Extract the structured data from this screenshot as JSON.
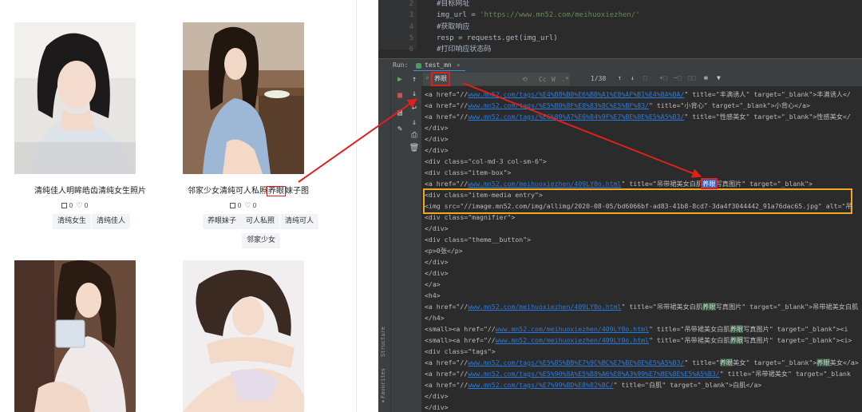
{
  "web": {
    "cards": [
      {
        "title": "清纯佳人明眸皓齿清纯女生照片",
        "likes": "0",
        "favs": "0",
        "tags": [
          "清纯女生",
          "清纯佳人"
        ]
      },
      {
        "title_before": "邻家少女清纯可人私照",
        "title_highlight": "养眼",
        "title_after": "妹子图",
        "likes": "0",
        "favs": "0",
        "tags": [
          "养眼妹子",
          "可人私照",
          "清纯可人",
          "邻家少女"
        ]
      },
      {
        "title": "",
        "tags": []
      },
      {
        "title": "",
        "tags": []
      }
    ]
  },
  "ide": {
    "editor_lines": [
      {
        "num": "2",
        "comment": "#目标网址"
      },
      {
        "num": "3",
        "code_before": "img_url = ",
        "string": "'https://www.mn52.com/meihuoxiezhen/'"
      },
      {
        "num": "4",
        "comment": "#获取响应"
      },
      {
        "num": "5",
        "code": "resp = requests.get(img_url)"
      },
      {
        "num": "6",
        "comment": "#打印响应状态码"
      }
    ],
    "run_label": "Run:",
    "run_tab": "test_mn",
    "find": {
      "query": "养眼",
      "count": "1/38",
      "options": [
        "Cc",
        "W",
        ".*"
      ]
    },
    "side_tabs": [
      "Structure",
      "Favorites"
    ],
    "console_lines": [
      {
        "t": "<a href=\"//",
        "u": "www.mn52.com/tags/%E4%B8%B0%E6%BB%A1%E8%AF%B1%E4%BA%BA/",
        "r": "\" title=\"丰满诱人\" target=\"_blank\">丰满诱人</"
      },
      {
        "t": "<a href=\"//",
        "u": "www.mn52.com/tags/%E5%B0%8F%E8%83%8C%E5%BF%83/",
        "r": "\" title=\"小背心\" target=\"_blank\">小背心</a>"
      },
      {
        "t": "<a href=\"//",
        "u": "www.mn52.com/tags/%E6%80%A7%E6%84%9F%E7%BE%8E%E5%A5%B3/",
        "r": "\" title=\"性感美女\" target=\"_blank\">性感美女</"
      },
      {
        "t": "</div>"
      },
      {
        "t": "</div>"
      },
      {
        "t": "</div>"
      },
      {
        "t": "<div class=\"col-md-3 col-sm-6\">"
      },
      {
        "t": "<div class=\"item-box\">"
      },
      {
        "t": "<a href=\"//",
        "u": "www.mn52.com/meihuoxiezhen/409LY0o.html",
        "r": "\" title=\"吊带裙美女白肌",
        "m": "养眼",
        "mc": true,
        "r2": "写真图片\" target=\"_blank\">"
      },
      {
        "t": "<div class=\"item-media entry\">"
      },
      {
        "t": "<img src=\"//image.mn52.com/img/allimg/2020-08-05/bd6066bf-ad83-41b8-8cd7-3da4f3044442_91a76dac65.jpg\" alt=\"吊"
      },
      {
        "t": "<div class=\"magnifier\">"
      },
      {
        "t": "</div>"
      },
      {
        "t": "<div class=\"theme__button\">"
      },
      {
        "t": "<p>0张</p>"
      },
      {
        "t": "</div>"
      },
      {
        "t": "</div>"
      },
      {
        "t": "</a>"
      },
      {
        "t": "<h4>"
      },
      {
        "t": "<a href=\"//",
        "u": "www.mn52.com/meihuoxiezhen/409LY0o.html",
        "r": "\" title=\"吊带裙美女白肌",
        "m": "养眼",
        "r2": "写真图片\" target=\"_blank\">吊带裙美女白肌"
      },
      {
        "t": "</h4>"
      },
      {
        "t": "<small><a href=\"//",
        "u": "www.mn52.com/meihuoxiezhen/409LY0o.html",
        "r": "\" title=\"吊带裙美女白肌",
        "m": "养眼",
        "r2": "写真图片\" target=\"_blank\"><i"
      },
      {
        "t": "<small><a href=\"//",
        "u": "www.mn52.com/meihuoxiezhen/409LY0o.html",
        "r": "\" title=\"吊带裙美女白肌",
        "m": "养眼",
        "r2": "写真图片\" target=\"_blank\"><i>"
      },
      {
        "t": "<div class=\"tags\">"
      },
      {
        "t": "<a href=\"//",
        "u": "www.mn52.com/tags/%E5%85%BB%E7%9C%BC%E7%BE%8E%E5%A5%B3/",
        "r": "\" title=\"",
        "m": "养眼",
        "r2": "美女\" target=\"_blank\">",
        "m2": "养眼",
        "r3": "美女</a>"
      },
      {
        "t": "<a href=\"//",
        "u": "www.mn52.com/tags/%E5%90%8A%E5%B8%A6%E8%A3%99%E7%BE%8E%E5%A5%B3/",
        "r": "\" title=\"吊带裙美女\" target=\"_blank"
      },
      {
        "t": "<a href=\"//",
        "u": "www.mn52.com/tags/%E7%99%BD%E8%82%8C/",
        "r": "\" title=\"白肌\" target=\"_blank\">白肌</a>"
      },
      {
        "t": "</div>"
      },
      {
        "t": "</div>"
      }
    ]
  },
  "colors": {
    "highlight_red": "#e0211b",
    "selection_orange": "#f5a623",
    "ide_bg": "#2b2b2b",
    "link_blue": "#287bde",
    "match_green": "#32593d"
  }
}
